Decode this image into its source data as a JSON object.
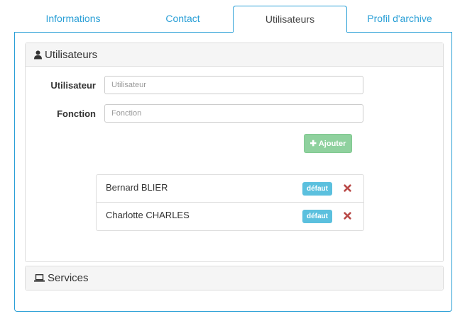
{
  "tabs": [
    {
      "label": "Informations",
      "active": false
    },
    {
      "label": "Contact",
      "active": false
    },
    {
      "label": "Utilisateurs",
      "active": true
    },
    {
      "label": "Profil d'archive",
      "active": false
    }
  ],
  "users_panel": {
    "title": "Utilisateurs",
    "icon": "user-icon",
    "fields": {
      "user": {
        "label": "Utilisateur",
        "placeholder": "Utilisateur",
        "value": ""
      },
      "function": {
        "label": "Fonction",
        "placeholder": "Fonction",
        "value": ""
      }
    },
    "add_button": {
      "label": "Ajouter",
      "icon": "plus-icon"
    },
    "users": [
      {
        "name": "Bernard BLIER",
        "badge": "défaut"
      },
      {
        "name": "Charlotte CHARLES",
        "badge": "défaut"
      }
    ]
  },
  "services_panel": {
    "title": "Services",
    "icon": "laptop-icon"
  },
  "colors": {
    "accent": "#2a9fd6",
    "success_light": "#8fd19e",
    "info": "#5bc0de",
    "danger": "#b94a48"
  }
}
